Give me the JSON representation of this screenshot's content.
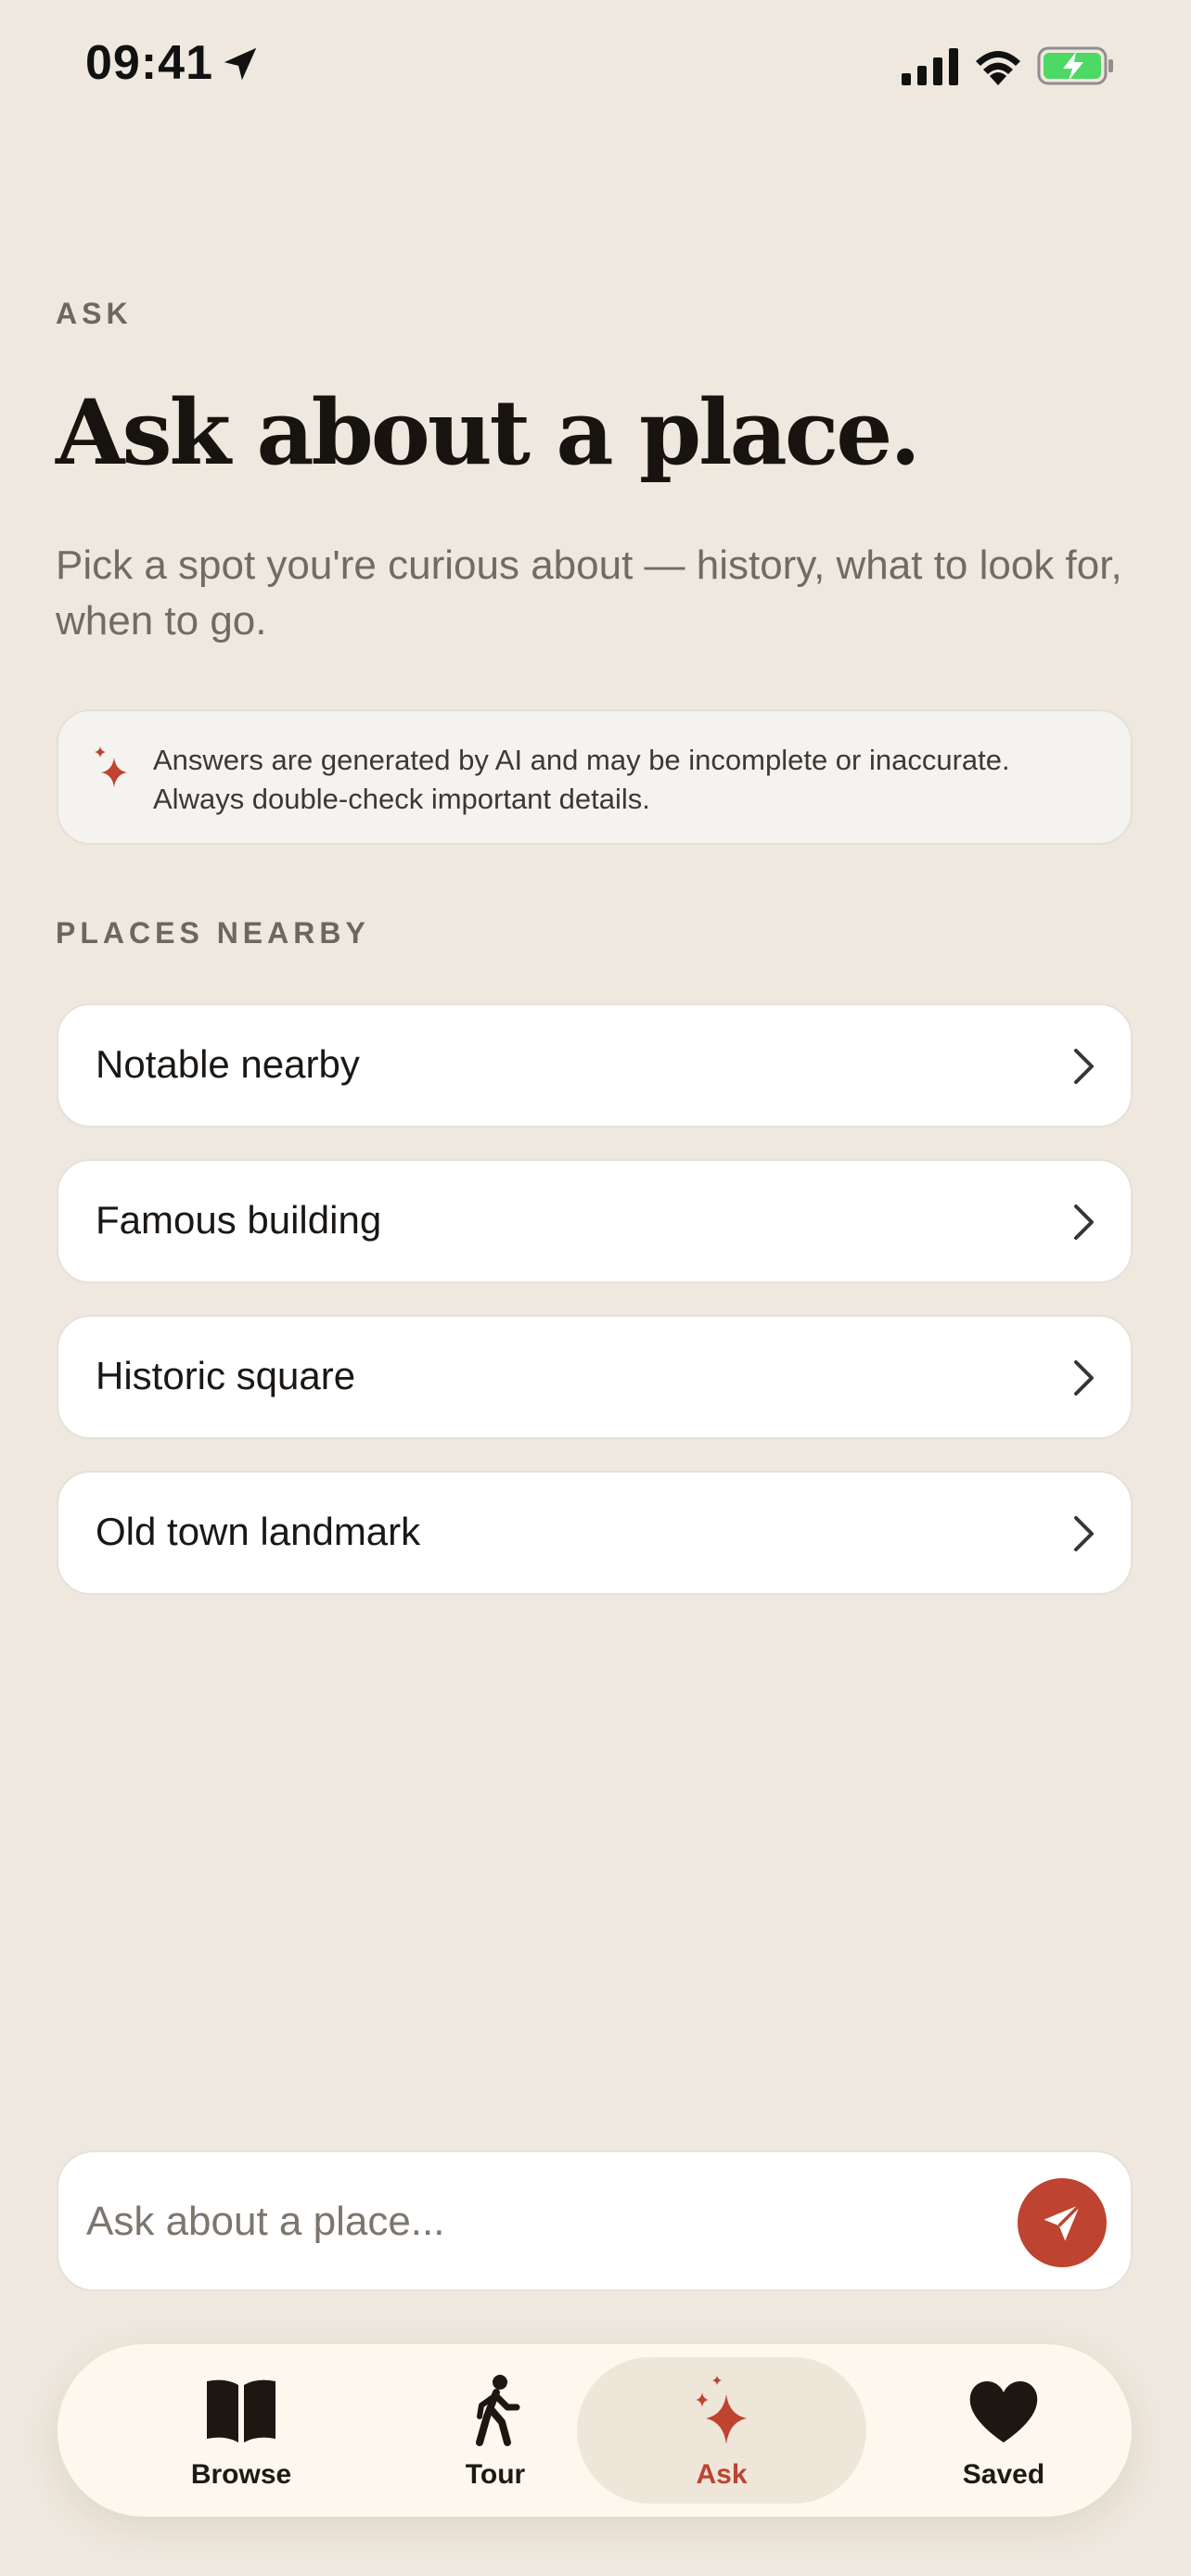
{
  "status_bar": {
    "time": "09:41"
  },
  "header": {
    "eyebrow": "ASK",
    "title": "Ask about a place.",
    "subtitle": "Pick a spot you're curious about — history, what to look for, when to go."
  },
  "notice": {
    "text": "Answers are generated by AI and may be incomplete or inaccurate. Always double-check important details."
  },
  "places": {
    "section_label": "PLACES NEARBY",
    "items": [
      {
        "label": "Notable nearby"
      },
      {
        "label": "Famous building"
      },
      {
        "label": "Historic square"
      },
      {
        "label": "Old town landmark"
      }
    ]
  },
  "ask": {
    "placeholder": "Ask about a place...",
    "value": ""
  },
  "tabs": [
    {
      "label": "Browse",
      "icon": "book-icon"
    },
    {
      "label": "Tour",
      "icon": "walking-person-icon"
    },
    {
      "label": "Ask",
      "icon": "sparkle-icon",
      "active": true
    },
    {
      "label": "Saved",
      "icon": "heart-icon"
    }
  ],
  "colors": {
    "background": "#EFE8DE",
    "accent": "#BE4330",
    "battery": "#4CD964"
  }
}
